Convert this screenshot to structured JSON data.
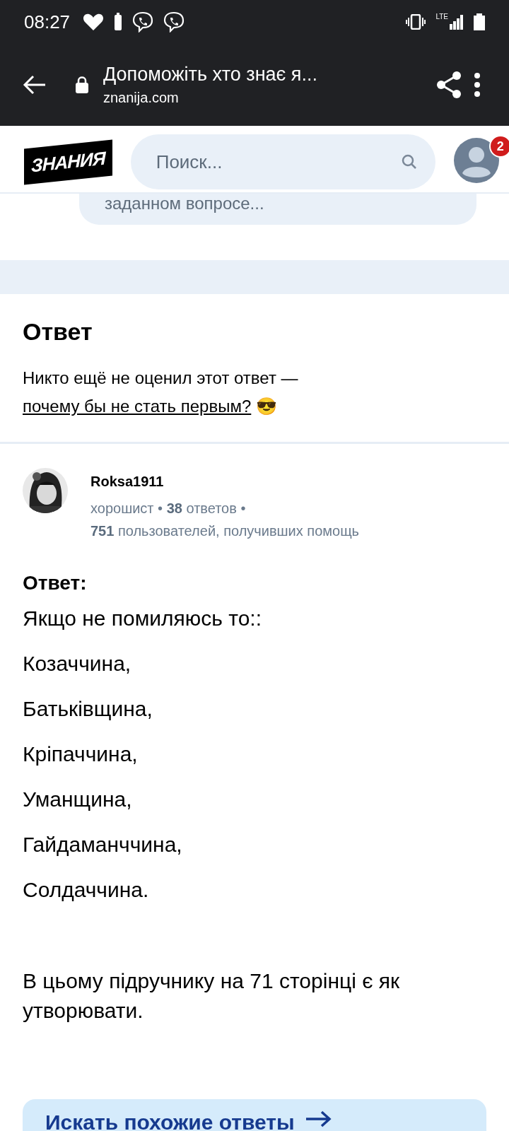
{
  "status_bar": {
    "time": "08:27",
    "network": "LTE"
  },
  "browser": {
    "title": "Допоможіть хто знає я...",
    "url": "znanija.com"
  },
  "header": {
    "logo": "ЗНАНИЯ",
    "search": {
      "placeholder": "Поиск..."
    },
    "notifications": "2"
  },
  "comment_field": {
    "text": "заданном вопросе..."
  },
  "rating_section": {
    "title": "Ответ",
    "text": "Никто ещё не оценил этот ответ — ",
    "link": "почему бы не стать первым?",
    "emoji": "😎"
  },
  "author": {
    "name": "Roksa1911",
    "rank": "хорошист",
    "separator": "•",
    "answers_count": "38",
    "answers_label": "ответов",
    "helped_count": "751",
    "helped_label": "пользователей, получивших помощь"
  },
  "answer": {
    "heading": "Ответ:",
    "paragraphs": [
      "Якщо не помиляюсь то::",
      "Козаччина,",
      "Батьківщина,",
      "Кріпаччина,",
      "Уманщина,",
      "Гайдаманччина,",
      "Солдаччина."
    ],
    "note": "В цьому підручнику на 71 сторінці є як утворювати."
  },
  "similar_button": {
    "label": "Искать похожие ответы"
  }
}
